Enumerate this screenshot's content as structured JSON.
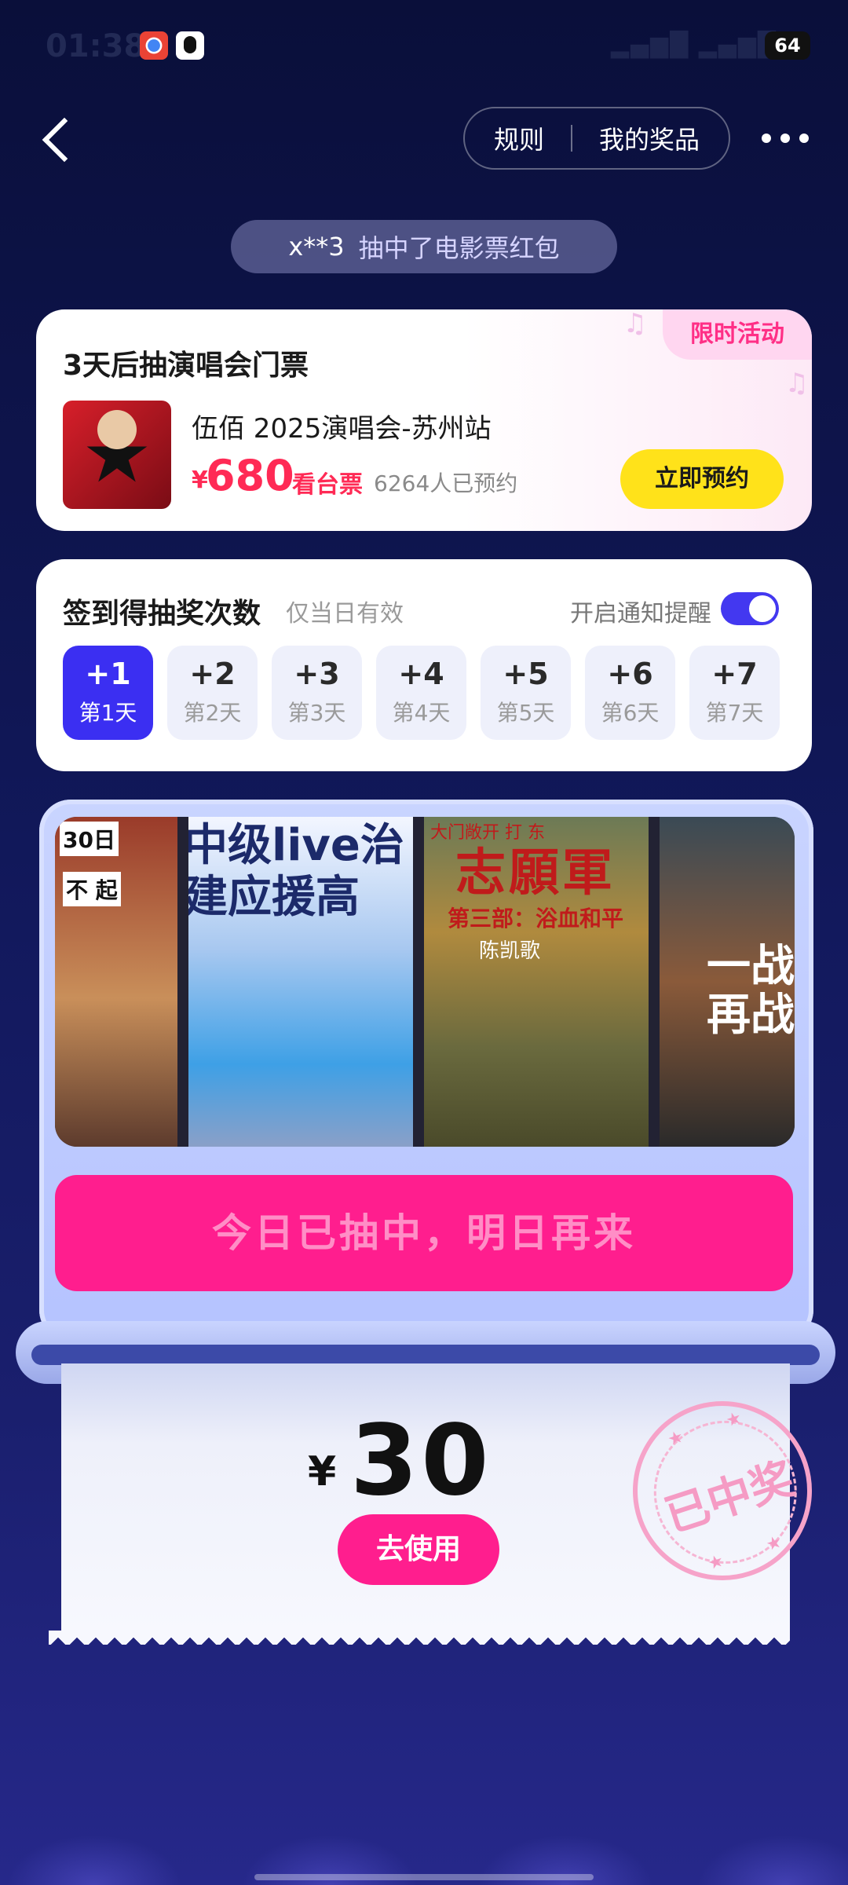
{
  "status_bar": {
    "time": "01:38",
    "battery": "64",
    "signal": "4G"
  },
  "nav": {
    "rules_label": "规则",
    "prizes_label": "我的奖品"
  },
  "ticker": {
    "user": "x**3",
    "message": "抽中了电影票红包"
  },
  "concert_card": {
    "title": "3天后抽演唱会门票",
    "badge": "限时活动",
    "concert_name": "伍佰 2025演唱会-苏州站",
    "currency": "¥",
    "price": "680",
    "ticket_type": "看台票",
    "reserved_count": "6264人已预约",
    "reserve_button": "立即预约"
  },
  "checkin_card": {
    "title": "签到得抽奖次数",
    "subtitle": "仅当日有效",
    "notify_label": "开启通知提醒",
    "notify_on": true,
    "days": [
      {
        "plus": "+1",
        "label": "第1天",
        "active": true
      },
      {
        "plus": "+2",
        "label": "第2天",
        "active": false
      },
      {
        "plus": "+3",
        "label": "第3天",
        "active": false
      },
      {
        "plus": "+4",
        "label": "第4天",
        "active": false
      },
      {
        "plus": "+5",
        "label": "第5天",
        "active": false
      },
      {
        "plus": "+6",
        "label": "第6天",
        "active": false
      },
      {
        "plus": "+7",
        "label": "第7天",
        "active": false
      }
    ]
  },
  "reel": {
    "posters": [
      {
        "text": "30日",
        "text2": "不  起"
      },
      {
        "text": "中级live治\n建应援高"
      },
      {
        "top": "大门敞开  打  东",
        "text": "志願軍",
        "sub": "第三部：浴血和平",
        "dir": "陈凯歌"
      },
      {
        "text": "一战\n再战"
      }
    ]
  },
  "draw_button": "今日已抽中，明日再来",
  "prize": {
    "currency": "¥",
    "amount": "30",
    "use_button": "去使用",
    "stamp_text": "已中奖"
  }
}
